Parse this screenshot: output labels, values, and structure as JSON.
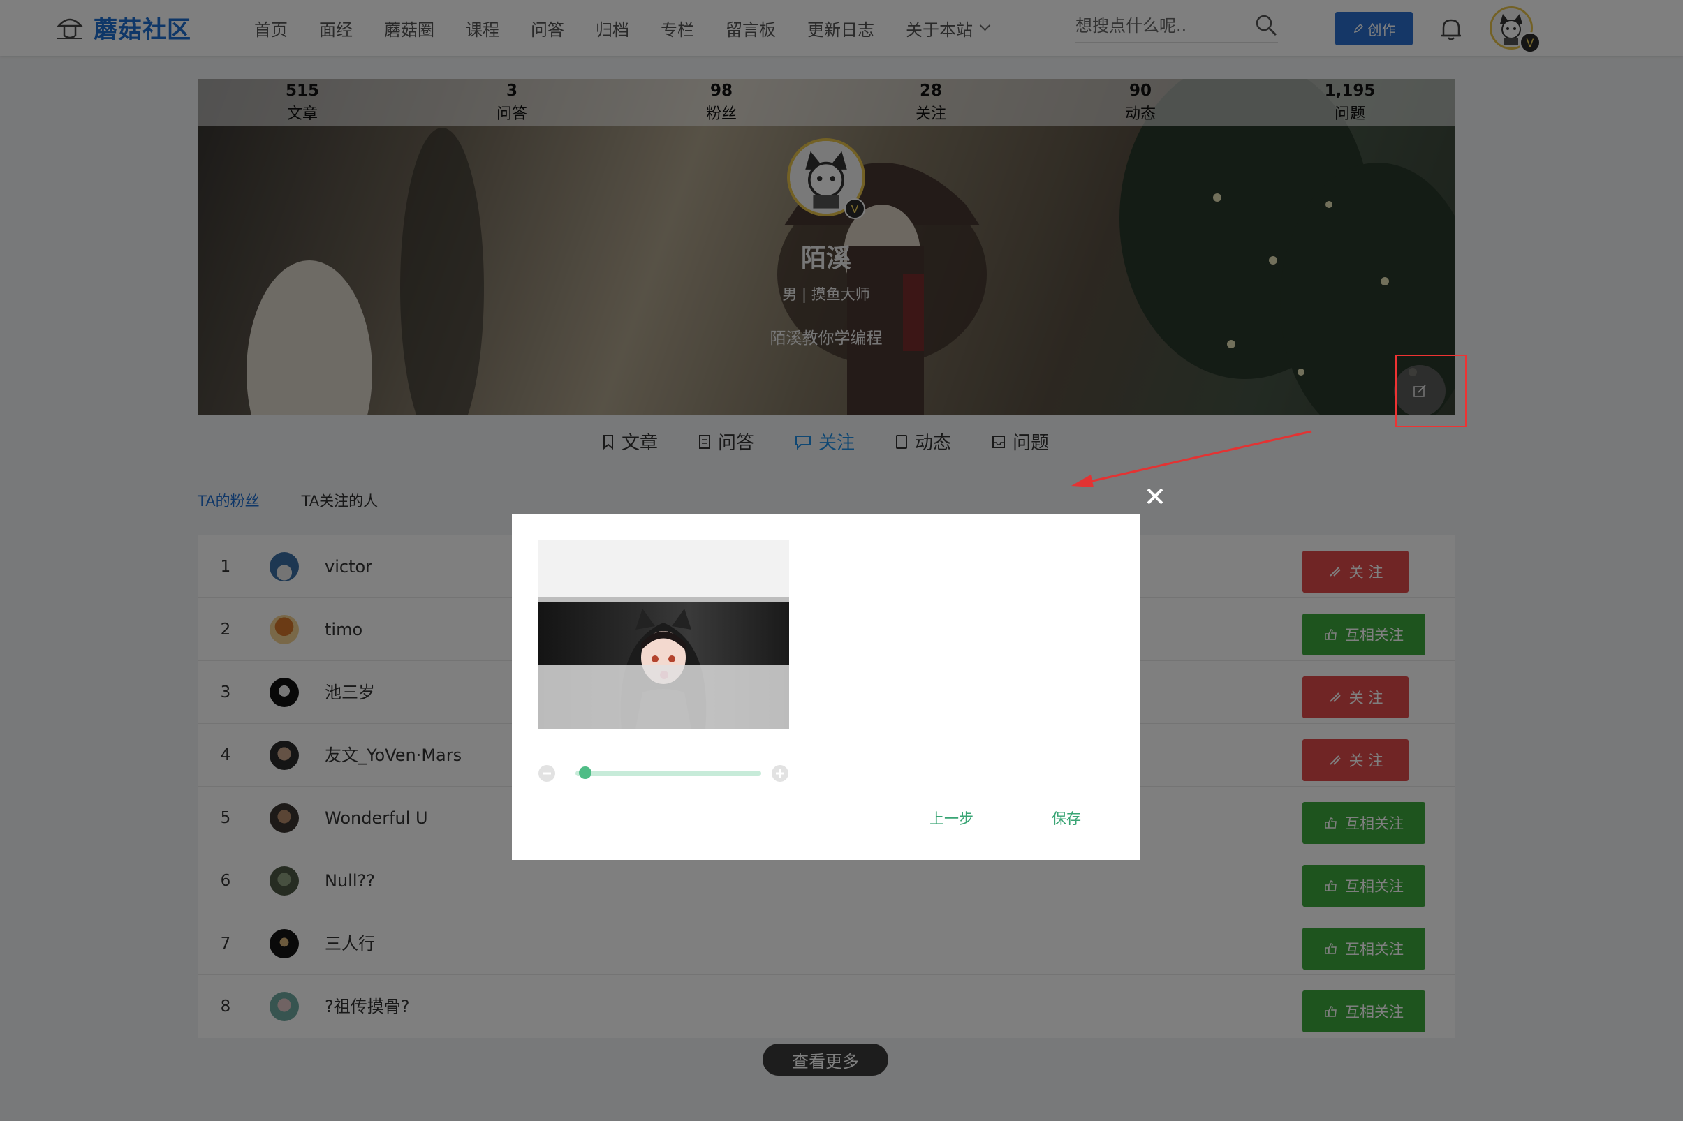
{
  "nav": {
    "logo_text": "蘑菇社区",
    "menu": [
      {
        "label": "首页"
      },
      {
        "label": "面经"
      },
      {
        "label": "蘑菇圈"
      },
      {
        "label": "课程"
      },
      {
        "label": "问答"
      },
      {
        "label": "归档"
      },
      {
        "label": "专栏"
      },
      {
        "label": "留言板"
      },
      {
        "label": "更新日志"
      },
      {
        "label": "关于本站"
      }
    ],
    "search_placeholder": "想搜点什么呢..",
    "create_label": "创作",
    "avatar_badge": "V"
  },
  "profile": {
    "stats": [
      {
        "value": "515",
        "label": "文章"
      },
      {
        "value": "3",
        "label": "问答"
      },
      {
        "value": "98",
        "label": "粉丝"
      },
      {
        "value": "28",
        "label": "关注"
      },
      {
        "value": "90",
        "label": "动态"
      },
      {
        "value": "1,195",
        "label": "问题"
      }
    ],
    "name": "陌溪",
    "meta": "男 | 摸鱼大师",
    "bio": "陌溪教你学编程",
    "avatar_badge": "V"
  },
  "tabs": [
    {
      "label": "文章"
    },
    {
      "label": "问答"
    },
    {
      "label": "关注",
      "active": true
    },
    {
      "label": "动态"
    },
    {
      "label": "问题"
    }
  ],
  "sub_tabs": [
    {
      "label": "TA的粉丝",
      "active": true
    },
    {
      "label": "TA关注的人"
    }
  ],
  "fans": [
    {
      "index": "1",
      "name": "victor",
      "button": "关 注",
      "type": "follow"
    },
    {
      "index": "2",
      "name": "timo",
      "button": "互相关注",
      "type": "mutual"
    },
    {
      "index": "3",
      "name": "池三岁",
      "button": "关 注",
      "type": "follow"
    },
    {
      "index": "4",
      "name": "友文_YoVen·Mars",
      "button": "关 注",
      "type": "follow"
    },
    {
      "index": "5",
      "name": "Wonderful U",
      "button": "互相关注",
      "type": "mutual"
    },
    {
      "index": "6",
      "name": "Null??",
      "button": "互相关注",
      "type": "mutual"
    },
    {
      "index": "7",
      "name": "三人行",
      "button": "互相关注",
      "type": "mutual"
    },
    {
      "index": "8",
      "name": "?祖传摸骨?",
      "button": "互相关注",
      "type": "mutual"
    }
  ],
  "more_label": "查看更多",
  "modal": {
    "zoom_level": 0.05,
    "prev_label": "上一步",
    "save_label": "保存"
  },
  "colors": {
    "brand": "#1f6fd1",
    "tab_active": "#1f8fe6",
    "follow": "#e04a4a",
    "mutual": "#3ca83c",
    "modal_accent": "#3aa575",
    "annotation": "#e33333"
  }
}
